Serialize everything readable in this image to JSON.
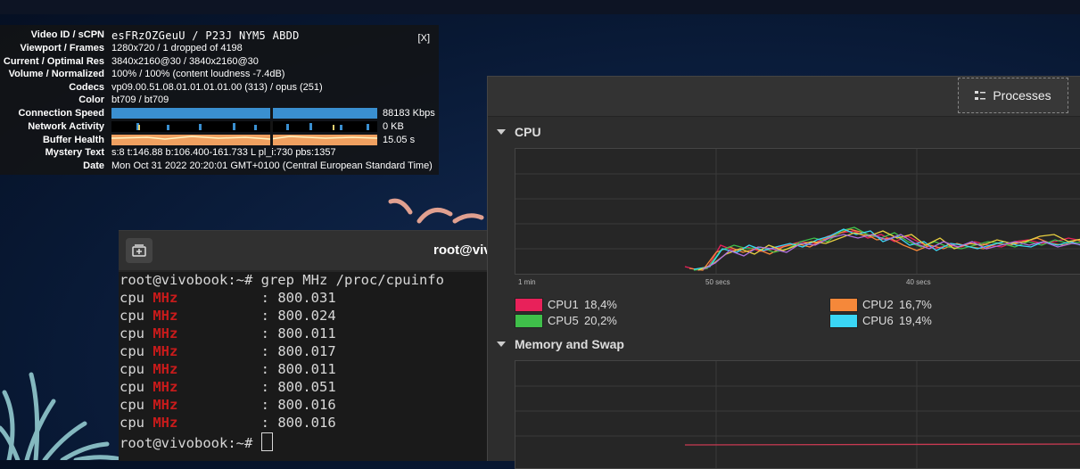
{
  "stats": {
    "close": "[X]",
    "rows": [
      {
        "label": "Video ID / sCPN",
        "value": "esFRzOZGeuU / P23J NYM5 ABDD"
      },
      {
        "label": "Viewport / Frames",
        "value": "1280x720 / 1 dropped of 4198"
      },
      {
        "label": "Current / Optimal Res",
        "value": "3840x2160@30 / 3840x2160@30"
      },
      {
        "label": "Volume / Normalized",
        "value": "100% / 100% (content loudness -7.4dB)"
      },
      {
        "label": "Codecs",
        "value": "vp09.00.51.08.01.01.01.01.00 (313) / opus (251)"
      },
      {
        "label": "Color",
        "value": "bt709 / bt709"
      },
      {
        "label": "Connection Speed",
        "value": "88183 Kbps"
      },
      {
        "label": "Network Activity",
        "value": "0 KB"
      },
      {
        "label": "Buffer Health",
        "value": "15.05 s"
      },
      {
        "label": "Mystery Text",
        "value": "s:8 t:146.88 b:106.400-161.733 L pl_i:730 pbs:1357"
      },
      {
        "label": "Date",
        "value": "Mon Oct 31 2022 20:20:01 GMT+0100 (Central European Standard Time)"
      }
    ]
  },
  "terminal": {
    "title": "root@vivo",
    "prompt": "root@vivobook:~# ",
    "command": "grep MHz /proc/cpuinfo",
    "cpu_word": "cpu",
    "mhz_word": "MHz",
    "lines": [
      "800.031",
      "800.024",
      "800.011",
      "800.017",
      "800.011",
      "800.051",
      "800.016",
      "800.016"
    ]
  },
  "sysmon": {
    "processes_label": "Processes",
    "cpu_section": "CPU",
    "memory_section": "Memory and Swap",
    "time_labels": [
      "1 min",
      "50 secs",
      "40 secs"
    ],
    "legend": [
      {
        "name": "CPU1",
        "value": "18,4%",
        "color": "#e8215a"
      },
      {
        "name": "CPU2",
        "value": "16,7%",
        "color": "#f5883a"
      },
      {
        "name": "CPU5",
        "value": "20,2%",
        "color": "#3fbf4a"
      },
      {
        "name": "CPU6",
        "value": "19,4%",
        "color": "#3ad6f5"
      }
    ]
  },
  "colors": {
    "connection_bar": "#3a8fd0",
    "buffer_bar": "#f0a060",
    "mhz_highlight": "#c81b1b"
  }
}
